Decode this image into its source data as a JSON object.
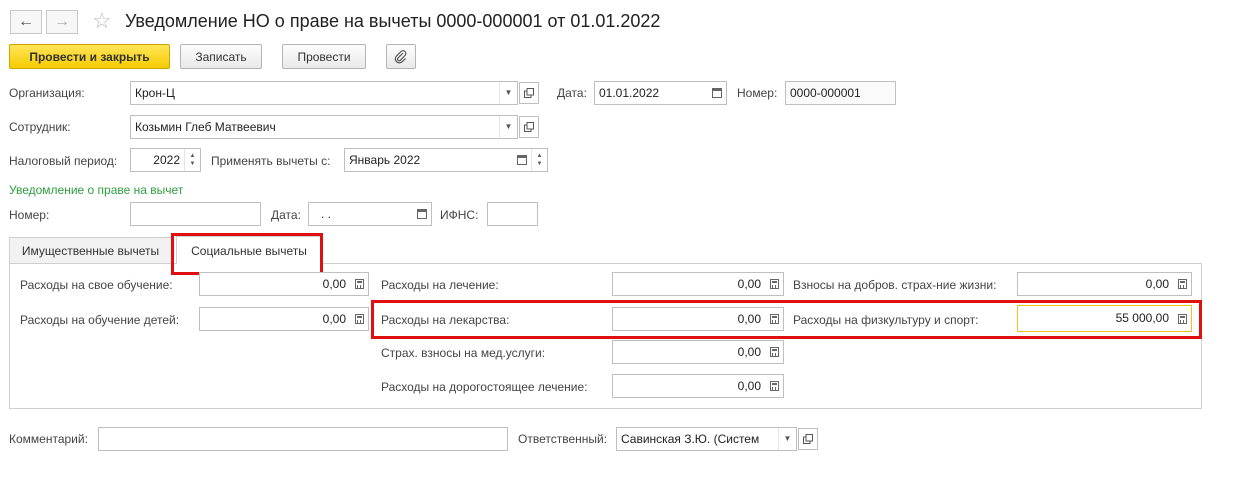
{
  "header": {
    "title": "Уведомление НО о праве на вычеты 0000-000001 от 01.01.2022"
  },
  "toolbar": {
    "post_close": "Провести и закрыть",
    "save": "Записать",
    "post": "Провести"
  },
  "form": {
    "org_label": "Организация:",
    "org_value": "Крон-Ц",
    "date_label": "Дата:",
    "date_value": "01.01.2022",
    "number_label": "Номер:",
    "number_value": "0000-000001",
    "employee_label": "Сотрудник:",
    "employee_value": "Козьмин Глеб Матвеевич",
    "period_label": "Налоговый период:",
    "period_value": "2022",
    "apply_label": "Применять вычеты с:",
    "apply_value": "Январь 2022",
    "notice_group": "Уведомление о праве на вычет",
    "notice_number_label": "Номер:",
    "notice_number_value": "",
    "notice_date_label": "Дата:",
    "notice_date_value": " .  .",
    "ifns_label": "ИФНС:",
    "ifns_value": ""
  },
  "tabs": [
    {
      "label": "Имущественные вычеты"
    },
    {
      "label": "Социальные вычеты"
    }
  ],
  "deductions": {
    "own_education_label": "Расходы на свое обучение:",
    "own_education_value": "0,00",
    "children_education_label": "Расходы на обучение детей:",
    "children_education_value": "0,00",
    "treatment_label": "Расходы на лечение:",
    "treatment_value": "0,00",
    "medicines_label": "Расходы на лекарства:",
    "medicines_value": "0,00",
    "insurance_med_label": "Страх. взносы на мед.услуги:",
    "insurance_med_value": "0,00",
    "expensive_treatment_label": "Расходы на дорогостоящее лечение:",
    "expensive_treatment_value": "0,00",
    "life_insurance_label": "Взносы на добров. страх-ние жизни:",
    "life_insurance_value": "0,00",
    "sport_label": "Расходы на физкультуру и спорт:",
    "sport_value": "55 000,00"
  },
  "footer": {
    "comment_label": "Комментарий:",
    "comment_value": "",
    "responsible_label": "Ответственный:",
    "responsible_value": "Савинская З.Ю. (Систем"
  },
  "colors": {
    "accent_button": "#f5cc00",
    "group_title": "#2e9e3f",
    "highlight": "#e01010",
    "focus_border": "#f0c020"
  }
}
